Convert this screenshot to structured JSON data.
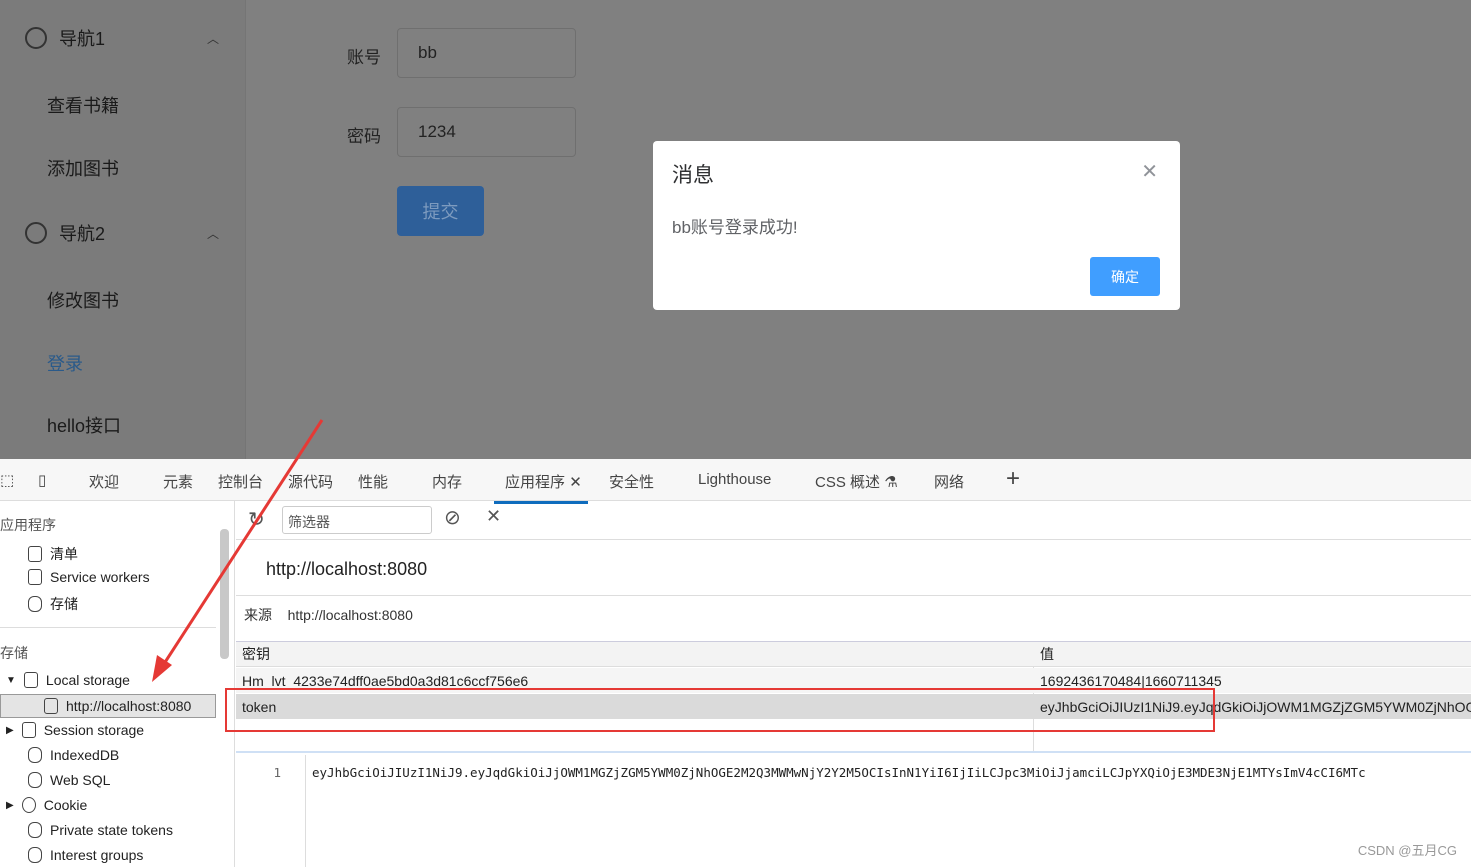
{
  "sidebar": {
    "nav1": "导航1",
    "nav2": "导航2",
    "items": [
      "查看书籍",
      "添加图书",
      "修改图书",
      "登录",
      "hello接口"
    ]
  },
  "form": {
    "account_label": "账号",
    "account_value": "bb",
    "password_label": "密码",
    "password_value": "1234",
    "submit": "提交"
  },
  "dialog": {
    "title": "消息",
    "message": "bb账号登录成功!",
    "ok": "确定"
  },
  "devtools": {
    "tabs": [
      "欢迎",
      "元素",
      "控制台",
      "源代码",
      "性能",
      "内存",
      "应用程序",
      "安全性",
      "Lighthouse",
      "CSS 概述",
      "网络"
    ],
    "active_tab": "应用程序",
    "tree": {
      "app_header": "应用程序",
      "manifest": "清单",
      "service_workers": "Service workers",
      "storage_item": "存储",
      "storage_header": "存储",
      "local_storage": "Local storage",
      "local_origin": "http://localhost:8080",
      "session_storage": "Session storage",
      "indexeddb": "IndexedDB",
      "websql": "Web SQL",
      "cookie": "Cookie",
      "private_tokens": "Private state tokens",
      "interest_groups": "Interest groups"
    },
    "filter_placeholder": "筛选器",
    "origin": "http://localhost:8080",
    "source_label": "来源",
    "source_value": "http://localhost:8080",
    "columns": [
      "密钥",
      "值"
    ],
    "rows": [
      {
        "key": "Hm_lvt_4233e74dff0ae5bd0a3d81c6ccf756e6",
        "value": "1692436170484|1660711345"
      },
      {
        "key": "token",
        "value": "eyJhbGciOiJIUzI1NiJ9.eyJqdGkiOiJjOWM1MGZjZGM5YWM0ZjNhOGE2M2Q3MWMwNjY2Y2M5OCIsInN1YiI6IjIiLCJpc3MiOiJjamciLCJpYXQiOjE3MDE3NjE1MTYsImV4cCI6MTc"
      }
    ],
    "preview_line": "1",
    "preview": "eyJhbGciOiJIUzI1NiJ9.eyJqdGkiOiJjOWM1MGZjZGM5YWM0ZjNhOGE2M2Q3MWMwNjY2Y2M5OCIsInN1YiI6IjIiLCJpc3MiOiJjamciLCJpYXQiOjE3MDE3NjE1MTYsImV4cCI6MTc"
  },
  "watermark": "CSDN @五月CG",
  "colors": {
    "accent": "#409eff",
    "highlight": "#e53935",
    "devtools_tab": "#0f6cbd"
  }
}
